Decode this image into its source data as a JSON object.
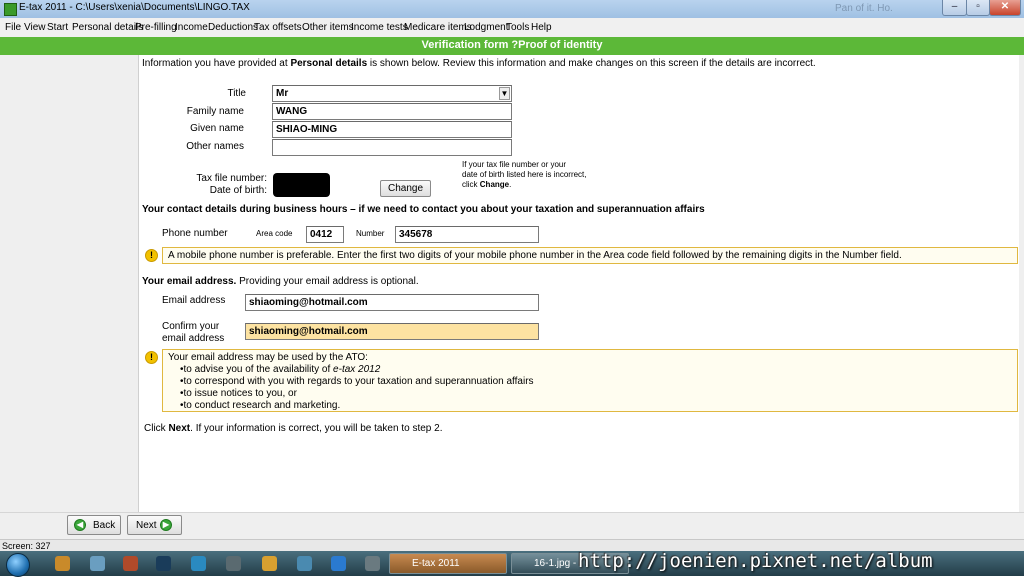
{
  "window": {
    "title": "E-tax 2011 - C:\\Users\\xenia\\Documents\\LINGO.TAX",
    "blurred_text": "Pan of it. Ho."
  },
  "menu": [
    "File",
    "View",
    "Start",
    "Personal details",
    "Pre-filling",
    "Income",
    "Deductions",
    "Tax offsets",
    "Other items",
    "Income tests",
    "Medicare items",
    "Lodgment",
    "Tools",
    "Help"
  ],
  "header": {
    "title": "Verification form ?Proof of identity"
  },
  "intro": {
    "pre": "Information you have provided at ",
    "bold": "Personal details",
    "post": " is shown below. Review this information and make changes on this screen if the details are incorrect."
  },
  "personal": {
    "title_label": "Title",
    "title_value": "Mr",
    "family_label": "Family name",
    "family_value": "WANG",
    "given_label": "Given name",
    "given_value": "SHIAO-MING",
    "other_label": "Other names",
    "other_value": "",
    "tfn_label": "Tax file number:",
    "dob_label": "Date of birth:",
    "change_button": "Change",
    "change_note_1": "If your tax file number or your",
    "change_note_2": "date of birth listed here is incorrect,",
    "change_note_3_pre": "click ",
    "change_note_3_bold": "Change",
    "change_note_3_post": "."
  },
  "contact": {
    "heading": "Your contact details during business hours – if we need to contact you about your taxation and superannuation affairs",
    "phone_label": "Phone number",
    "area_label": "Area code",
    "area_value": "0412",
    "number_label": "Number",
    "number_value": "345678",
    "mobile_note": "A mobile phone number is preferable. Enter the first two digits of your mobile phone number in the Area code field followed by the remaining digits in the Number field."
  },
  "email": {
    "heading_bold": "Your email address.",
    "heading_rest": " Providing your email address is optional.",
    "email_label": "Email address",
    "email_value": "shiaoming@hotmail.com",
    "confirm_label_1": "Confirm your",
    "confirm_label_2": "email address",
    "confirm_value": "shiaoming@hotmail.com",
    "note_title": "Your email address may be used by the ATO:",
    "note_items": [
      "to advise you of the availability of ",
      "to correspond with you with regards to your taxation and superannuation affairs",
      "to issue notices to you, or",
      "to conduct research and marketing."
    ],
    "etax_italic": "e-tax 2012"
  },
  "footer_text": {
    "pre": "Click ",
    "bold": "Next",
    "post": ". If your information is correct, you will be taken to step 2."
  },
  "nav": {
    "back": "Back",
    "next": "Next"
  },
  "status": "Screen: 327",
  "taskbar": {
    "task1": "E-tax 2011",
    "task2": "16-1.jpg -"
  },
  "watermark": "http://joenien.pixnet.net/album"
}
